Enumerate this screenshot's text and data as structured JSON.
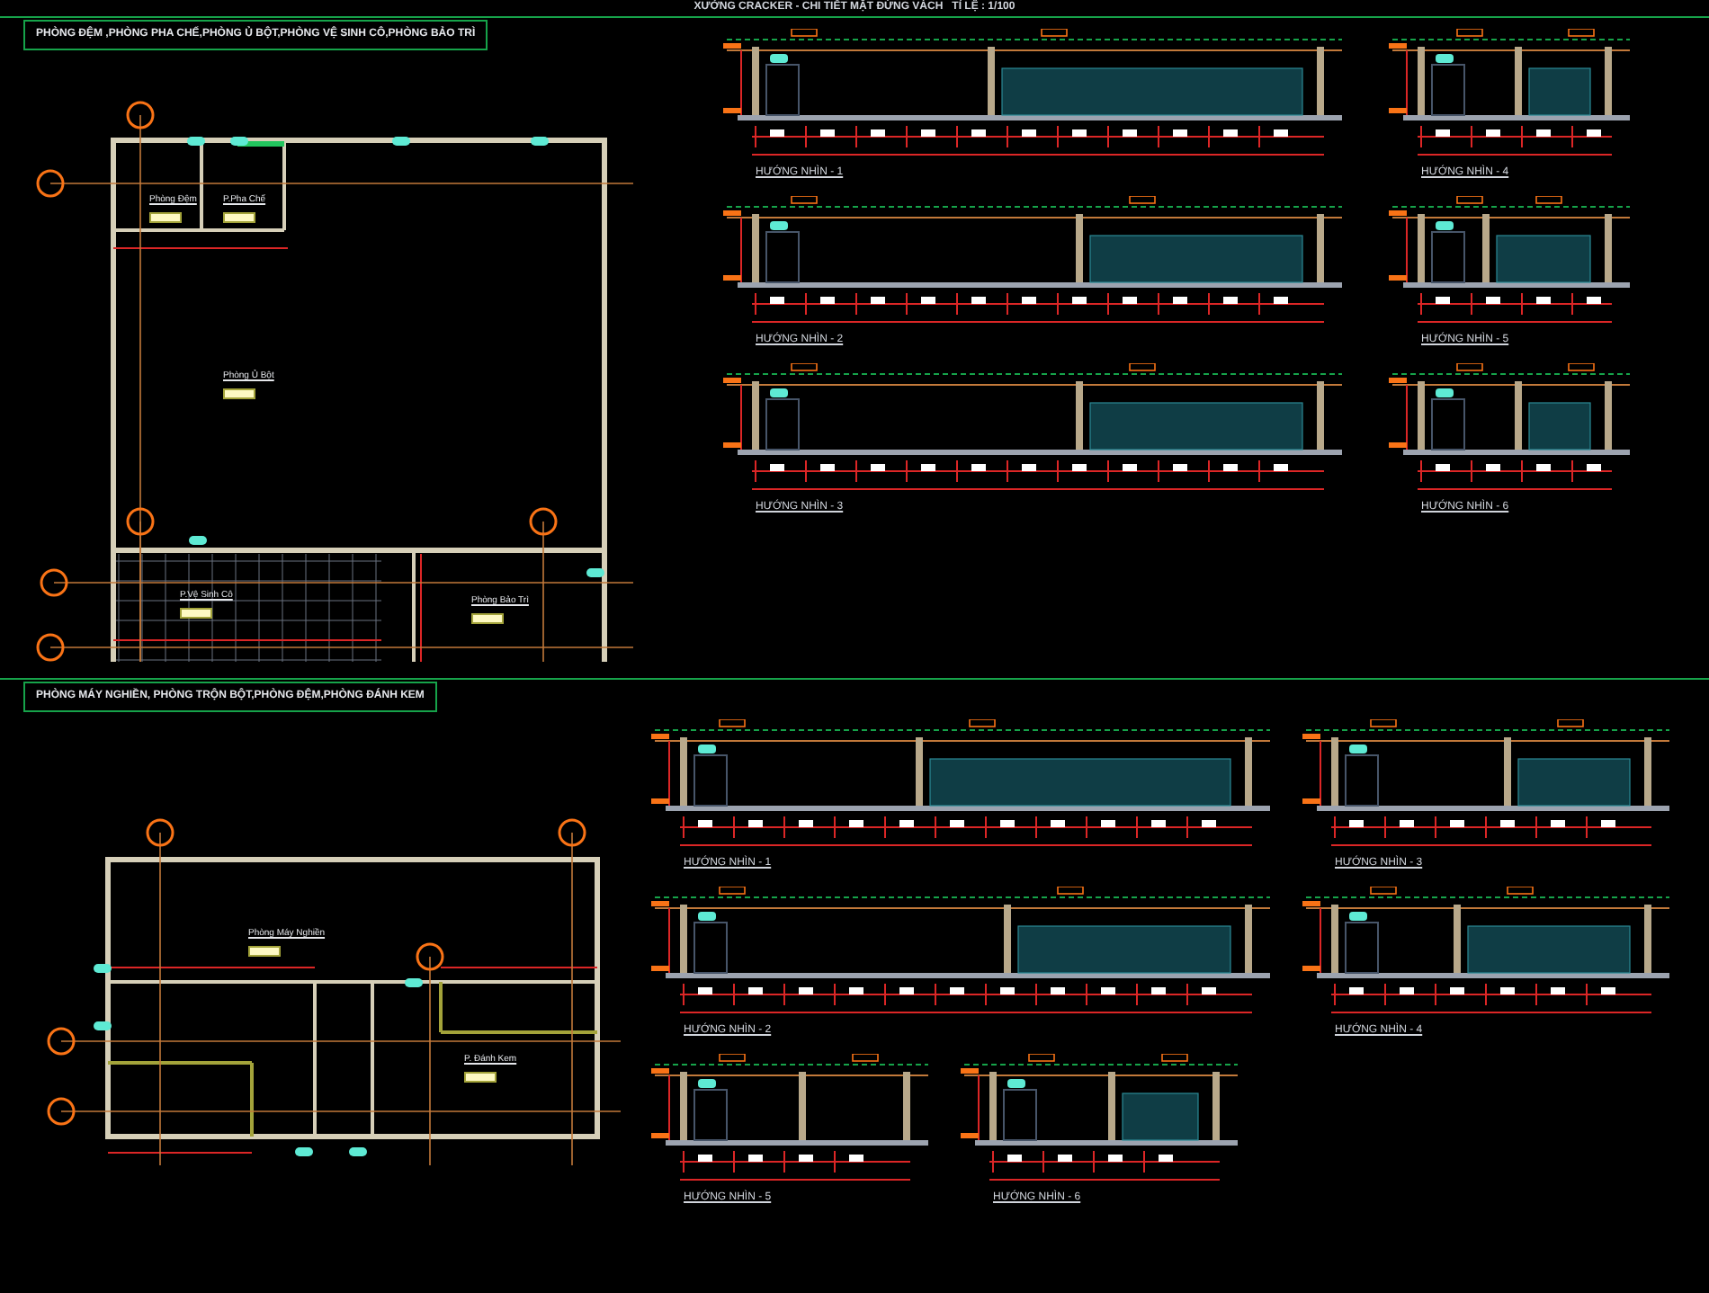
{
  "title": "XƯỞNG CRACKER - CHI TIẾT MẶT ĐỨNG VÁCH   TỈ LỆ : 1/100",
  "sections": [
    {
      "heading": "PHÒNG ĐỆM ,PHÒNG PHA CHẾ,PHÒNG Ủ BỘT,PHÒNG VỆ SINH CÔ,PHÒNG BẢO TRÌ",
      "rooms": [
        "Phòng Đệm",
        "P.Pha Chế",
        "Phòng Ủ Bột",
        "P.Vệ Sinh Cô",
        "Phòng Bảo Trì"
      ],
      "views": [
        {
          "label": "HƯỚNG NHÌN - 1",
          "kind": "wide"
        },
        {
          "label": "HƯỚNG NHÌN - 4",
          "kind": "narrow"
        },
        {
          "label": "HƯỚNG NHÌN - 2",
          "kind": "wide"
        },
        {
          "label": "HƯỚNG NHÌN - 5",
          "kind": "narrow"
        },
        {
          "label": "HƯỚNG NHÌN - 3",
          "kind": "wide"
        },
        {
          "label": "HƯỚNG NHÌN - 6",
          "kind": "narrow"
        }
      ]
    },
    {
      "heading": "PHÒNG MÁY NGHIỀN, PHÒNG TRỘN BỘT,PHÒNG ĐỆM,PHÒNG ĐÁNH KEM",
      "rooms": [
        "Phòng Máy Nghiền",
        "P. Đánh Kem"
      ],
      "views": [
        {
          "label": "HƯỚNG NHÌN - 1",
          "kind": "wide"
        },
        {
          "label": "HƯỚNG NHÌN - 3",
          "kind": "medium"
        },
        {
          "label": "HƯỚNG NHÌN - 2",
          "kind": "wide"
        },
        {
          "label": "HƯỚNG NHÌN - 4",
          "kind": "medium"
        },
        {
          "label": "HƯỚNG NHÌN - 5",
          "kind": "small"
        },
        {
          "label": "HƯỚNG NHÌN - 6",
          "kind": "small"
        }
      ]
    }
  ]
}
